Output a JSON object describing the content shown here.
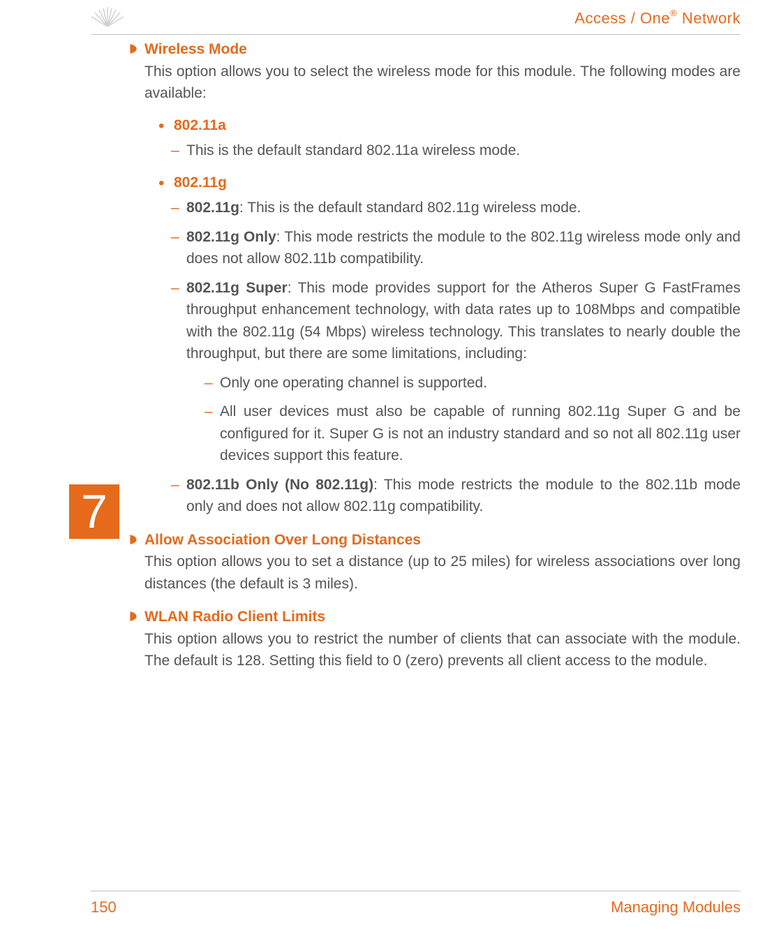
{
  "header": {
    "title_part1": "Access / One",
    "title_reg": "®",
    "title_part2": " Network"
  },
  "chapter_number": "7",
  "sections": [
    {
      "title": "Wireless Mode",
      "body": "This option allows you to select the wireless mode for this module. The following modes are available:",
      "subs": [
        {
          "title": "802.11a",
          "dashes": [
            {
              "text": "This is the default standard 802.11a wireless mode."
            }
          ]
        },
        {
          "title": "802.11g",
          "dashes": [
            {
              "bold": "802.11g",
              "text": ": This is the default standard 802.11g wireless mode."
            },
            {
              "bold": "802.11g Only",
              "text": ": This mode restricts the module to the 802.11g wireless mode only and does not allow 802.11b compatibility."
            },
            {
              "bold": "802.11g Super",
              "text": ": This mode provides support for the Atheros Super G FastFrames throughput enhancement technology, with data rates up to 108Mbps and compatible with the 802.11g (54 Mbps) wireless technology. This translates to nearly double the throughput, but there are some limitations, including:",
              "nested": [
                "Only one operating channel is supported.",
                "All user devices must also be capable of running 802.11g Super G and be configured for it. Super G is not an industry standard and so not all 802.11g user devices support this feature."
              ]
            },
            {
              "bold": "802.11b Only (No 802.11g)",
              "text": ": This mode restricts the module to the 802.11b mode only and does not allow 802.11g compatibility."
            }
          ]
        }
      ]
    },
    {
      "title": "Allow Association Over Long Distances",
      "body": "This option allows you to set a distance (up to 25 miles) for wireless associations over long distances (the default is 3 miles)."
    },
    {
      "title": "WLAN Radio Client Limits",
      "body": "This option allows you to restrict the number of clients that can associate with the module. The default is 128. Setting this field to 0 (zero) prevents all client access to the module."
    }
  ],
  "footer": {
    "page_number": "150",
    "title": "Managing Modules"
  }
}
